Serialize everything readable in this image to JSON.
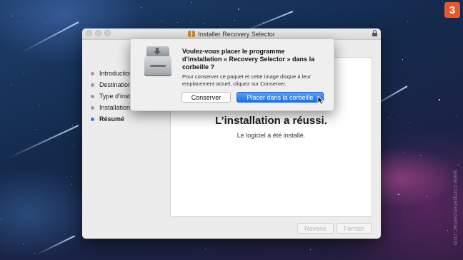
{
  "badge": "3",
  "watermark": "www.competencemac.com",
  "window": {
    "title": "Installer Recovery Selector",
    "steps": [
      {
        "label": "Introduction",
        "active": false
      },
      {
        "label": "Destination",
        "active": false
      },
      {
        "label": "Type d’installation",
        "active": false
      },
      {
        "label": "Installation",
        "active": false
      },
      {
        "label": "Résumé",
        "active": true
      }
    ],
    "headline": "L’installation a réussi.",
    "subtext": "Le logiciel a été installé.",
    "back_label": "Revenir",
    "close_label": "Fermer"
  },
  "dialog": {
    "title": "Voulez-vous placer le programme d’installation « Recovery Selector » dans la corbeille ?",
    "message": "Pour conserver ce paquet et cette image disque à leur emplacement actuel, cliquez sur Conserver.",
    "keep_label": "Conserver",
    "trash_label": "Placer dans la corbeille"
  },
  "colors": {
    "accent": "#2f7ae0",
    "badge": "#e8572a"
  }
}
